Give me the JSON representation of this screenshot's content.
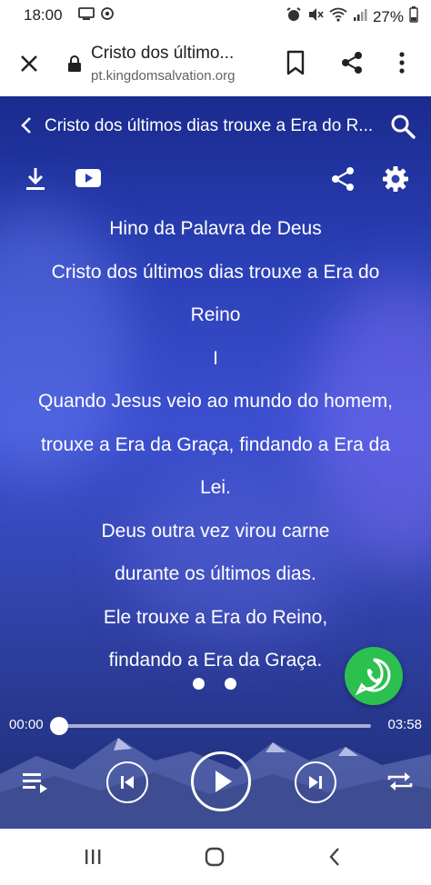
{
  "status_bar": {
    "time": "18:00",
    "battery": "27%",
    "icons_left": [
      "screen-icon",
      "sync-icon"
    ],
    "icons_right": [
      "alarm-icon",
      "mute-icon",
      "wifi-icon",
      "signal-icon"
    ]
  },
  "browser": {
    "title": "Cristo dos último...",
    "url": "pt.kingdomsalvation.org"
  },
  "player": {
    "header_title": "Cristo dos últimos dias trouxe a Era do R...",
    "lyrics": [
      "Hino da Palavra de Deus",
      "Cristo dos últimos dias trouxe a Era do",
      "Reino",
      "I",
      "Quando Jesus veio ao mundo do homem,",
      "trouxe a Era da Graça, findando a Era da",
      "Lei.",
      "Deus outra vez virou carne",
      "durante os últimos dias.",
      "Ele trouxe a Era do Reino,",
      "findando a Era da Graça."
    ],
    "page_dots": 2,
    "time_current": "00:00",
    "time_total": "03:58",
    "progress": 0.0
  },
  "colors": {
    "accent_bg": "#2a3fb5",
    "whatsapp": "#2cc04f",
    "text": "#ffffff"
  }
}
